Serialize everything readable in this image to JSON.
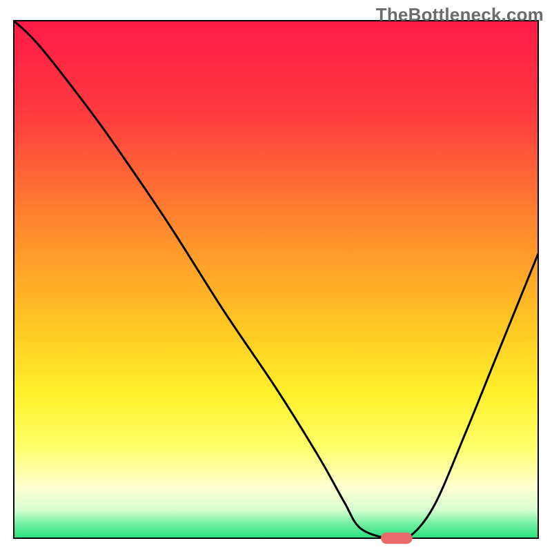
{
  "watermark": "TheBottleneck.com",
  "chart_data": {
    "type": "line",
    "title": "",
    "xlabel": "",
    "ylabel": "",
    "xlim": [
      0,
      100
    ],
    "ylim": [
      0,
      100
    ],
    "grid": false,
    "legend": false,
    "background_gradient": {
      "stops": [
        {
          "offset": 0.0,
          "color": "#ff1a48"
        },
        {
          "offset": 0.18,
          "color": "#ff3b3f"
        },
        {
          "offset": 0.4,
          "color": "#ff8a2e"
        },
        {
          "offset": 0.58,
          "color": "#ffc423"
        },
        {
          "offset": 0.72,
          "color": "#fff02a"
        },
        {
          "offset": 0.82,
          "color": "#ffff66"
        },
        {
          "offset": 0.9,
          "color": "#ffffcf"
        },
        {
          "offset": 0.945,
          "color": "#d9ffd2"
        },
        {
          "offset": 0.97,
          "color": "#7af0a8"
        },
        {
          "offset": 1.0,
          "color": "#27e07a"
        }
      ]
    },
    "series": [
      {
        "name": "bottleneck-curve",
        "color": "#000000",
        "x": [
          0,
          5,
          15,
          22,
          30,
          40,
          50,
          58,
          63,
          66,
          71,
          75,
          80,
          86,
          92,
          100
        ],
        "y": [
          100,
          95,
          82,
          72,
          60,
          44,
          29,
          16,
          7,
          2,
          0,
          0,
          6,
          20,
          35,
          55
        ]
      }
    ],
    "marker": {
      "name": "optimal-marker",
      "shape": "capsule",
      "color": "#e96a6a",
      "x_center": 73,
      "y": 0,
      "width_x_units": 6,
      "height_y_units": 2.2
    }
  }
}
